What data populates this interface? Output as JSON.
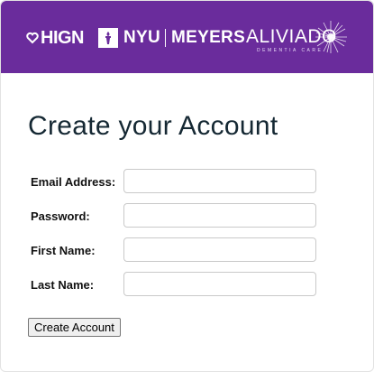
{
  "banner": {
    "background_color": "#6a2c9c",
    "logos": {
      "hign": "HIGN",
      "nyu": "NYU",
      "meyers": "MEYERS",
      "aliviado": "ALIVIADO",
      "aliviado_sub": "DEMENTIA CARE"
    }
  },
  "form": {
    "title": "Create your Account",
    "fields": {
      "email": {
        "label": "Email Address:",
        "value": ""
      },
      "password": {
        "label": "Password:",
        "value": ""
      },
      "first_name": {
        "label": "First Name:",
        "value": ""
      },
      "last_name": {
        "label": "Last Name:",
        "value": ""
      }
    },
    "submit_label": "Create Account"
  }
}
